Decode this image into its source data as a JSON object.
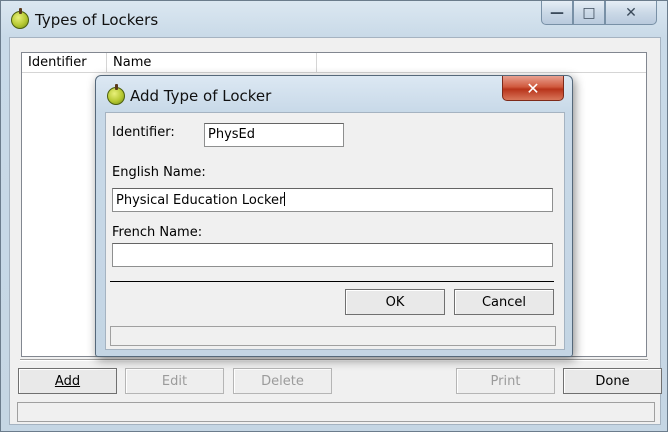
{
  "window": {
    "title": "Types of Lockers",
    "caption_buttons": [
      "minimize",
      "maximize",
      "close"
    ]
  },
  "list": {
    "columns": [
      "Identifier",
      "Name"
    ],
    "rows": []
  },
  "buttons": {
    "add": "Add",
    "edit": "Edit",
    "delete": "Delete",
    "print": "Print",
    "done": "Done"
  },
  "dialog": {
    "title": "Add Type of Locker",
    "identifier_label": "Identifier:",
    "identifier_value": "PhysEd",
    "english_label": "English Name:",
    "english_value": "Physical Education Locker",
    "french_label": "French Name:",
    "french_value": "",
    "ok": "OK",
    "cancel": "Cancel"
  },
  "icons": {
    "app": "apple-icon",
    "close": "close-icon"
  }
}
